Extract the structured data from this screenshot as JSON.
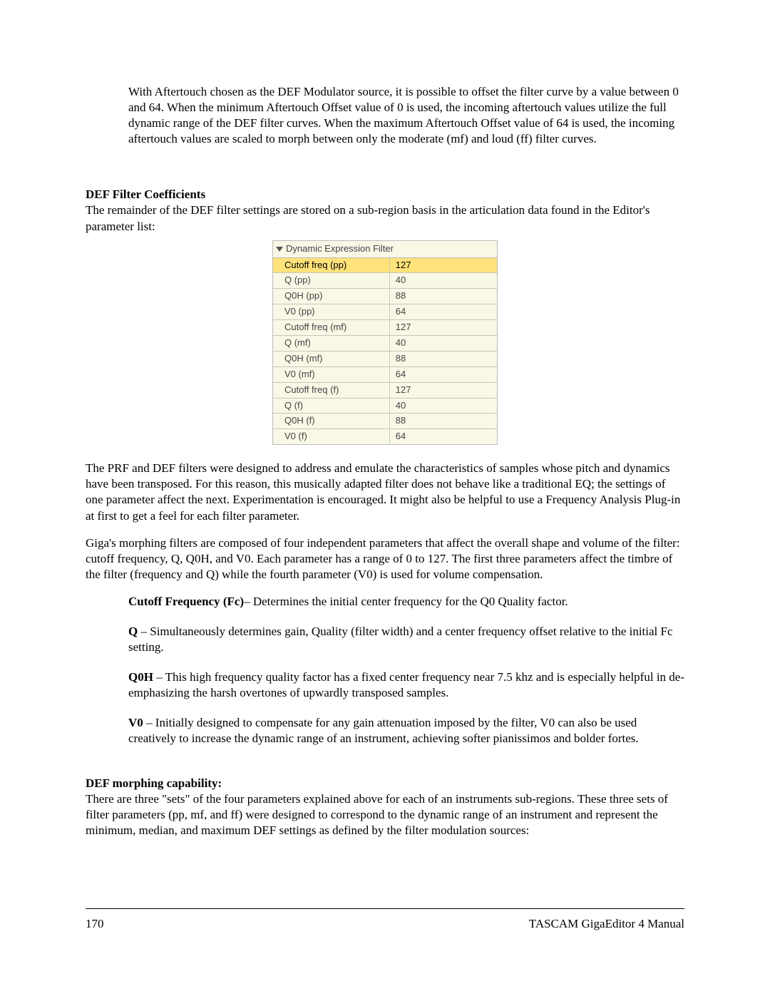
{
  "para1": "With Aftertouch chosen as the DEF Modulator source, it is possible to offset the filter curve by a value between 0 and 64. When the minimum Aftertouch Offset value of 0 is used, the incoming aftertouch values utilize the full dynamic range of the DEF filter curves. When the maximum Aftertouch Offset value of 64 is used, the incoming aftertouch values are scaled to morph between only the moderate (mf) and loud (ff) filter curves.",
  "heading1": "DEF Filter Coefficients",
  "para2": "The remainder of the DEF filter settings are stored on a sub-region basis in the articulation data found in the Editor's parameter list:",
  "table": {
    "title": "Dynamic Expression Filter",
    "rows": [
      {
        "name": "Cutoff freq (pp)",
        "value": "127",
        "selected": true
      },
      {
        "name": "Q (pp)",
        "value": "40",
        "selected": false
      },
      {
        "name": "Q0H (pp)",
        "value": "88",
        "selected": false
      },
      {
        "name": "V0 (pp)",
        "value": "64",
        "selected": false
      },
      {
        "name": "Cutoff freq (mf)",
        "value": "127",
        "selected": false
      },
      {
        "name": "Q (mf)",
        "value": "40",
        "selected": false
      },
      {
        "name": "Q0H (mf)",
        "value": "88",
        "selected": false
      },
      {
        "name": "V0 (mf)",
        "value": "64",
        "selected": false
      },
      {
        "name": "Cutoff freq (f)",
        "value": "127",
        "selected": false
      },
      {
        "name": "Q (f)",
        "value": "40",
        "selected": false
      },
      {
        "name": "Q0H (f)",
        "value": "88",
        "selected": false
      },
      {
        "name": "V0 (f)",
        "value": "64",
        "selected": false
      }
    ]
  },
  "para3": "The PRF and DEF filters were designed to address and emulate the characteristics of samples whose pitch and dynamics have been transposed. For this reason, this musically adapted filter does not behave like a traditional EQ; the settings of one parameter affect the next. Experimentation is encouraged. It might also be helpful to use a Frequency Analysis Plug-in at first to get a feel for each filter parameter.",
  "para4": "Giga's morphing filters are composed of four independent parameters that affect the overall shape and volume of the filter: cutoff frequency, Q, Q0H, and V0. Each parameter has a range of 0 to 127. The first three parameters affect the timbre of the filter (frequency and Q) while the fourth parameter (V0) is used for volume compensation.",
  "defs": [
    {
      "term": "Cutoff Frequency (Fc)",
      "sep": "– ",
      "body": "Determines the initial center frequency for the Q0 Quality factor."
    },
    {
      "term": "Q",
      "sep": " – ",
      "body": "Simultaneously determines gain, Quality (filter width) and a center frequency offset relative to the initial Fc setting."
    },
    {
      "term": "Q0H",
      "sep": " – ",
      "body": "This high frequency quality factor has a fixed center frequency near 7.5 khz and is especially helpful in de-emphasizing the harsh overtones of upwardly transposed samples."
    },
    {
      "term": "V0",
      "sep": " – ",
      "body": "Initially designed to compensate for any gain attenuation imposed by the filter, V0 can also be used creatively to increase the dynamic range of an instrument, achieving softer pianissimos and bolder fortes."
    }
  ],
  "heading2": "DEF morphing capability:",
  "para5": "There are three \"sets\" of the four parameters explained above for each of an instruments sub-regions. These three sets of filter parameters (pp, mf, and ff) were designed to correspond to the dynamic range of an instrument and represent the minimum, median, and maximum DEF settings as defined by the filter modulation sources:",
  "footer": {
    "page": "170",
    "title": "TASCAM GigaEditor 4 Manual"
  }
}
